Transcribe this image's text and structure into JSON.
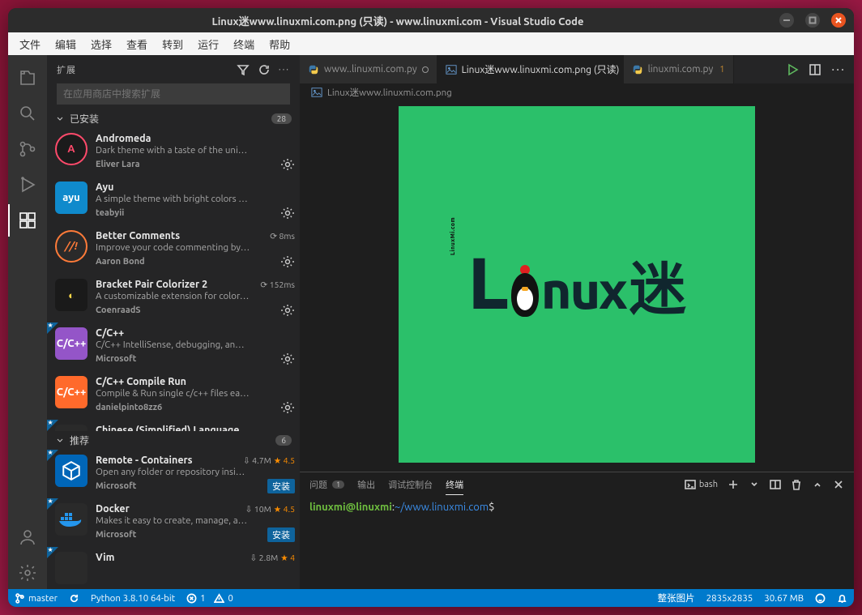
{
  "title": "Linux迷www.linuxmi.com.png (只读) - www.linuxmi.com - Visual Studio Code",
  "menu": [
    "文件",
    "编辑",
    "选择",
    "查看",
    "转到",
    "运行",
    "终端",
    "帮助"
  ],
  "sidebar": {
    "title": "扩展",
    "search_placeholder": "在应用商店中搜索扩展",
    "section_installed": "已安装",
    "installed_count": "28",
    "section_recommended": "推荐",
    "recommended_count": "6",
    "installed": [
      {
        "name": "Andromeda",
        "desc": "Dark theme with a taste of the uni…",
        "author": "Eliver Lara",
        "stat": "",
        "iconBg": "#1b1b1b",
        "iconTxt": "A",
        "iconColor": "#ff4a6b"
      },
      {
        "name": "Ayu",
        "desc": "A simple theme with bright colors …",
        "author": "teabyii",
        "stat": "",
        "iconBg": "#0f8acc",
        "iconTxt": "ayu",
        "iconColor": "#fff"
      },
      {
        "name": "Better Comments",
        "desc": "Improve your code commenting by…",
        "author": "Aaron Bond",
        "stat": "⟳ 8ms",
        "iconBg": "#2a2a2a",
        "iconTxt": "//!",
        "iconColor": "#ff7b39"
      },
      {
        "name": "Bracket Pair Colorizer 2",
        "desc": "A customizable extension for color…",
        "author": "CoenraadS",
        "stat": "⟳ 152ms",
        "iconBg": "#1a1a1a",
        "iconTxt": "◐",
        "iconColor": "#ffd94a"
      },
      {
        "name": "C/C++",
        "desc": "C/C++ IntelliSense, debugging, an…",
        "author": "Microsoft",
        "stat": "",
        "iconBg": "#9455c8",
        "iconTxt": "C/C++",
        "iconColor": "#fff",
        "ribbon": true
      },
      {
        "name": "C/C++ Compile Run",
        "desc": "Compile & Run single c/c++ files ea…",
        "author": "danielpinto8zz6",
        "stat": "",
        "iconBg": "#ff6a2b",
        "iconTxt": "C/C++",
        "iconColor": "#fff"
      },
      {
        "name": "Chinese (Simplified) Language …",
        "desc": "",
        "author": "",
        "stat": "",
        "iconBg": "#2a2a2a",
        "iconTxt": "",
        "iconColor": "#fff",
        "ribbon": true,
        "partial": true
      }
    ],
    "recommended": [
      {
        "name": "Remote - Containers",
        "desc": "Open any folder or repository insi…",
        "author": "Microsoft",
        "dl": "4.7M",
        "star": "4.5",
        "iconBg": "#0066b8",
        "iconSvg": "cube",
        "install": "安装",
        "ribbon": true
      },
      {
        "name": "Docker",
        "desc": "Makes it easy to create, manage, a…",
        "author": "Microsoft",
        "dl": "10M",
        "star": "4.5",
        "iconBg": "#2a2a2a",
        "iconSvg": "docker",
        "install": "安装",
        "ribbon": true
      },
      {
        "name": "Vim",
        "desc": "",
        "author": "",
        "dl": "2.8M",
        "star": "4",
        "iconBg": "#2a2a2a",
        "iconSvg": "",
        "install": "",
        "ribbon": true,
        "partial": true
      }
    ]
  },
  "tabs": [
    {
      "label": "www..linuxmi.com.py",
      "kind": "py",
      "active": false,
      "mod": false,
      "closed": true
    },
    {
      "label": "Linux迷www.linuxmi.com.png (只读)",
      "kind": "img",
      "active": true,
      "mod": false
    },
    {
      "label": "linuxmi.com.py",
      "kind": "py",
      "active": false,
      "mod": true,
      "modcount": "1"
    }
  ],
  "crumb_icon": "img",
  "crumb": "Linux迷www.linuxmi.com.png",
  "logo": {
    "L": "L",
    "rest": "nux",
    "cjk": "迷",
    "mi": "LinuxMi.com"
  },
  "panel": {
    "tabs": {
      "problems": "问题",
      "problems_count": "1",
      "output": "输出",
      "debug": "调试控制台",
      "terminal": "终端"
    },
    "shell": "bash",
    "prompt_user": "linuxmi@linuxmi",
    "prompt_sep": ":",
    "prompt_path": "~/www.linuxmi.com",
    "prompt_end": "$"
  },
  "status": {
    "branch": "master",
    "python": "Python 3.8.10 64-bit",
    "err": "1",
    "warn": "0",
    "img_label": "整张图片",
    "dim": "2835x2835",
    "size": "30.67 MB"
  }
}
